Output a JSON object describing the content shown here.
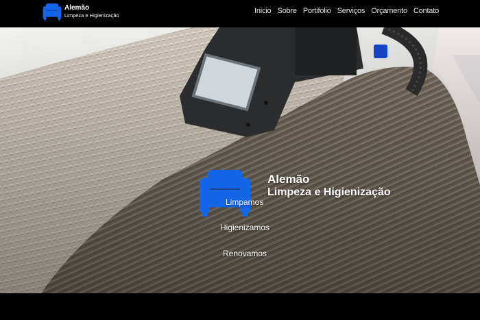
{
  "brand": {
    "name": "Alemão",
    "subtitle": "Limpeza e Higienização",
    "icon": "armchair-icon",
    "icon_color": "#1466e8"
  },
  "nav": {
    "items": [
      "Inicio",
      "Sobre",
      "Portifolio",
      "Serviços",
      "Orçamento",
      "Contato"
    ]
  },
  "hero": {
    "name": "Alemão",
    "subtitle": "Limpeza e Higienização",
    "taglines": [
      "Limpamos",
      "Higienizamos",
      "Renovamos"
    ]
  }
}
